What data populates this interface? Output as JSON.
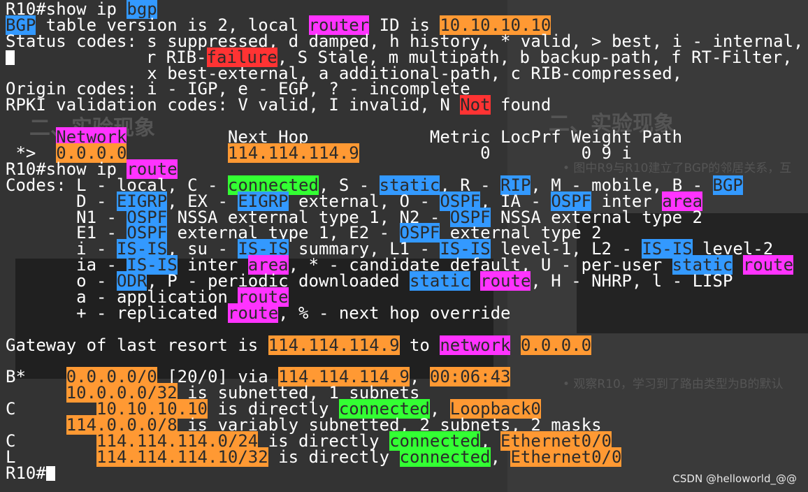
{
  "colors": {
    "blue": "#3399ff",
    "magenta": "#ff33ff",
    "orange": "#ff9933",
    "green": "#33ff33",
    "red": "#ff3333"
  },
  "background": {
    "heading_left": "二、实验现象",
    "heading_right": "二、实验现象",
    "bullet_right_1": "• 图中R9与R10建立了BGP的邻居关系，互",
    "bullet_right_2": "• 观察R10，学习到了路由类型为B的默认"
  },
  "terminal": {
    "lines": [
      [
        {
          "t": "R10#show ip "
        },
        {
          "t": "bgp",
          "c": "blue"
        }
      ],
      [
        {
          "t": "BGP",
          "c": "blue"
        },
        {
          "t": " table version is 2, local "
        },
        {
          "t": "router",
          "c": "magenta"
        },
        {
          "t": " ID is "
        },
        {
          "t": "10.10.10.10",
          "c": "orange"
        }
      ],
      [
        {
          "t": "Status codes: s suppressed, d damped, h history, * valid, > best, i - internal,"
        }
      ],
      [
        {
          "cursor": true
        },
        {
          "t": "             r RIB-"
        },
        {
          "t": "failure",
          "c": "red"
        },
        {
          "t": ", S Stale, m multipath, b backup-path, f RT-Filter,"
        }
      ],
      [
        {
          "t": "              x best-external, a additional-path, c RIB-compressed,"
        }
      ],
      [
        {
          "t": "Origin codes: i - IGP, e - EGP, ? - incomplete"
        }
      ],
      [
        {
          "t": "RPKI validation codes: V valid, I invalid, N "
        },
        {
          "t": "Not",
          "c": "red"
        },
        {
          "t": " found"
        }
      ],
      [],
      [
        {
          "t": "     "
        },
        {
          "t": "Network",
          "c": "magenta"
        },
        {
          "t": "          Next Hop            Metric LocPrf Weight Path"
        }
      ],
      [
        {
          "t": " *>  "
        },
        {
          "t": "0.0.0.0",
          "c": "orange"
        },
        {
          "t": "          "
        },
        {
          "t": "114.114.114.9",
          "c": "orange"
        },
        {
          "t": "            0         0 9 i"
        }
      ],
      [
        {
          "t": "R10#show ip "
        },
        {
          "t": "route",
          "c": "magenta"
        }
      ],
      [
        {
          "t": "Codes: L - local, C - "
        },
        {
          "t": "connected",
          "c": "green"
        },
        {
          "t": ", S - "
        },
        {
          "t": "static",
          "c": "blue"
        },
        {
          "t": ", R - "
        },
        {
          "t": "RIP",
          "c": "blue"
        },
        {
          "t": ", M - mobile, B - "
        },
        {
          "t": "BGP",
          "c": "blue"
        }
      ],
      [
        {
          "t": "       D - "
        },
        {
          "t": "EIGRP",
          "c": "blue"
        },
        {
          "t": ", EX - "
        },
        {
          "t": "EIGRP",
          "c": "blue"
        },
        {
          "t": " external, O - "
        },
        {
          "t": "OSPF",
          "c": "blue"
        },
        {
          "t": ", IA - "
        },
        {
          "t": "OSPF",
          "c": "blue"
        },
        {
          "t": " inter "
        },
        {
          "t": "area",
          "c": "magenta"
        }
      ],
      [
        {
          "t": "       N1 - "
        },
        {
          "t": "OSPF",
          "c": "blue"
        },
        {
          "t": " NSSA external type 1, N2 - "
        },
        {
          "t": "OSPF",
          "c": "blue"
        },
        {
          "t": " NSSA external type 2"
        }
      ],
      [
        {
          "t": "       E1 - "
        },
        {
          "t": "OSPF",
          "c": "blue"
        },
        {
          "t": " external type 1, E2 - "
        },
        {
          "t": "OSPF",
          "c": "blue"
        },
        {
          "t": " external type 2"
        }
      ],
      [
        {
          "t": "       i - "
        },
        {
          "t": "IS-IS",
          "c": "blue"
        },
        {
          "t": ", su - "
        },
        {
          "t": "IS-IS",
          "c": "blue"
        },
        {
          "t": " summary, L1 - "
        },
        {
          "t": "IS-IS",
          "c": "blue"
        },
        {
          "t": " level-1, L2 - "
        },
        {
          "t": "IS-IS",
          "c": "blue"
        },
        {
          "t": " level-2"
        }
      ],
      [
        {
          "t": "       ia - "
        },
        {
          "t": "IS-IS",
          "c": "blue"
        },
        {
          "t": " inter "
        },
        {
          "t": "area",
          "c": "magenta"
        },
        {
          "t": ", * - candidate default, U - per-user "
        },
        {
          "t": "static",
          "c": "blue"
        },
        {
          "t": " "
        },
        {
          "t": "route",
          "c": "magenta"
        }
      ],
      [
        {
          "t": "       o - "
        },
        {
          "t": "ODR",
          "c": "blue"
        },
        {
          "t": ", P - periodic downloaded "
        },
        {
          "t": "static",
          "c": "blue"
        },
        {
          "t": " "
        },
        {
          "t": "route",
          "c": "magenta"
        },
        {
          "t": ", H - NHRP, l - LISP"
        }
      ],
      [
        {
          "t": "       a - application "
        },
        {
          "t": "route",
          "c": "magenta"
        }
      ],
      [
        {
          "t": "       + - replicated "
        },
        {
          "t": "route",
          "c": "magenta"
        },
        {
          "t": ", % - next hop override"
        }
      ],
      [],
      [
        {
          "t": "Gateway of last resort is "
        },
        {
          "t": "114.114.114.9",
          "c": "orange"
        },
        {
          "t": " to "
        },
        {
          "t": "network",
          "c": "magenta"
        },
        {
          "t": " "
        },
        {
          "t": "0.0.0.0",
          "c": "orange"
        }
      ],
      [],
      [
        {
          "t": "B*    "
        },
        {
          "t": "0.0.0.0/0",
          "c": "orange"
        },
        {
          "t": " [20/0] via "
        },
        {
          "t": "114.114.114.9",
          "c": "orange"
        },
        {
          "t": ", "
        },
        {
          "t": "00:06:43",
          "c": "orange"
        }
      ],
      [
        {
          "t": "      "
        },
        {
          "t": "10.0.0.0/32",
          "c": "orange"
        },
        {
          "t": " is subnetted, 1 subnets"
        }
      ],
      [
        {
          "t": "C        "
        },
        {
          "t": "10.10.10.10",
          "c": "orange"
        },
        {
          "t": " is directly "
        },
        {
          "t": "connected",
          "c": "green"
        },
        {
          "t": ", "
        },
        {
          "t": "Loopback0",
          "c": "orange"
        }
      ],
      [
        {
          "t": "      "
        },
        {
          "t": "114.0.0.0/8",
          "c": "orange"
        },
        {
          "t": " is variably subnetted, 2 subnets, 2 masks"
        }
      ],
      [
        {
          "t": "C        "
        },
        {
          "t": "114.114.114.0/24",
          "c": "orange"
        },
        {
          "t": " is directly "
        },
        {
          "t": "connected",
          "c": "green"
        },
        {
          "t": ", "
        },
        {
          "t": "Ethernet0/0",
          "c": "orange"
        }
      ],
      [
        {
          "t": "L        "
        },
        {
          "t": "114.114.114.10/32",
          "c": "orange"
        },
        {
          "t": " is directly "
        },
        {
          "t": "connected",
          "c": "green"
        },
        {
          "t": ", "
        },
        {
          "t": "Ethernet0/0",
          "c": "orange"
        }
      ],
      [
        {
          "t": "R10#"
        },
        {
          "cursor": true
        }
      ]
    ]
  },
  "watermark": "CSDN @helloworld_@@"
}
